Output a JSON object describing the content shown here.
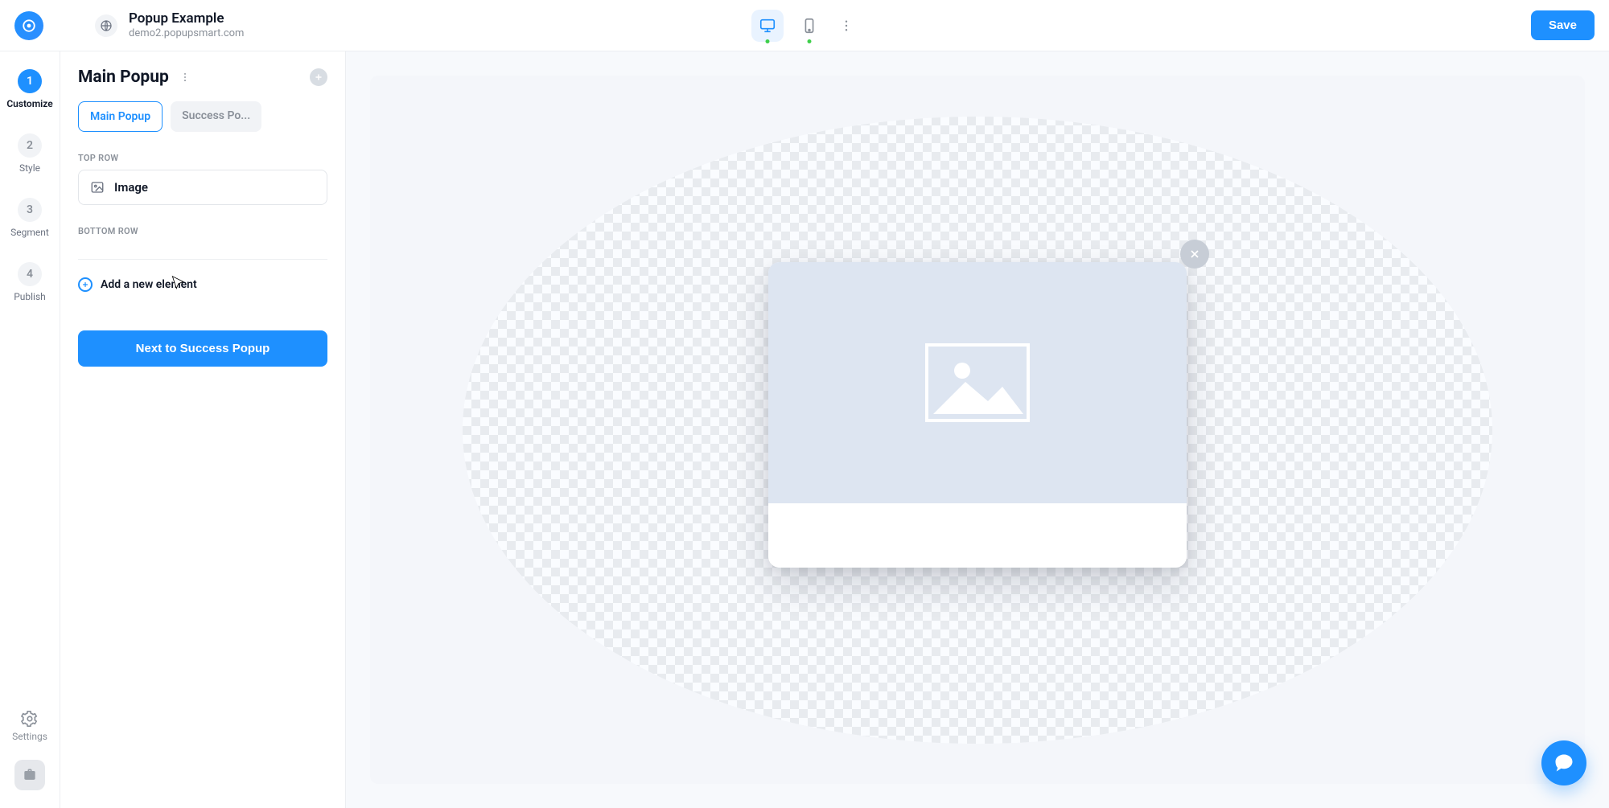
{
  "header": {
    "title": "Popup Example",
    "subtitle": "demo2.popupsmart.com",
    "save_label": "Save"
  },
  "steps": [
    {
      "num": "1",
      "label": "Customize",
      "active": true
    },
    {
      "num": "2",
      "label": "Style",
      "active": false
    },
    {
      "num": "3",
      "label": "Segment",
      "active": false
    },
    {
      "num": "4",
      "label": "Publish",
      "active": false
    }
  ],
  "settings_label": "Settings",
  "panel": {
    "title": "Main Popup",
    "tabs": [
      {
        "label": "Main Popup",
        "active": true
      },
      {
        "label": "Success Po...",
        "active": false
      }
    ],
    "sections": {
      "top_label": "TOP ROW",
      "top_items": [
        {
          "label": "Image",
          "icon": "image-icon"
        }
      ],
      "bottom_label": "BOTTOM ROW"
    },
    "add_element_label": "Add a new element",
    "next_label": "Next to Success Popup"
  }
}
